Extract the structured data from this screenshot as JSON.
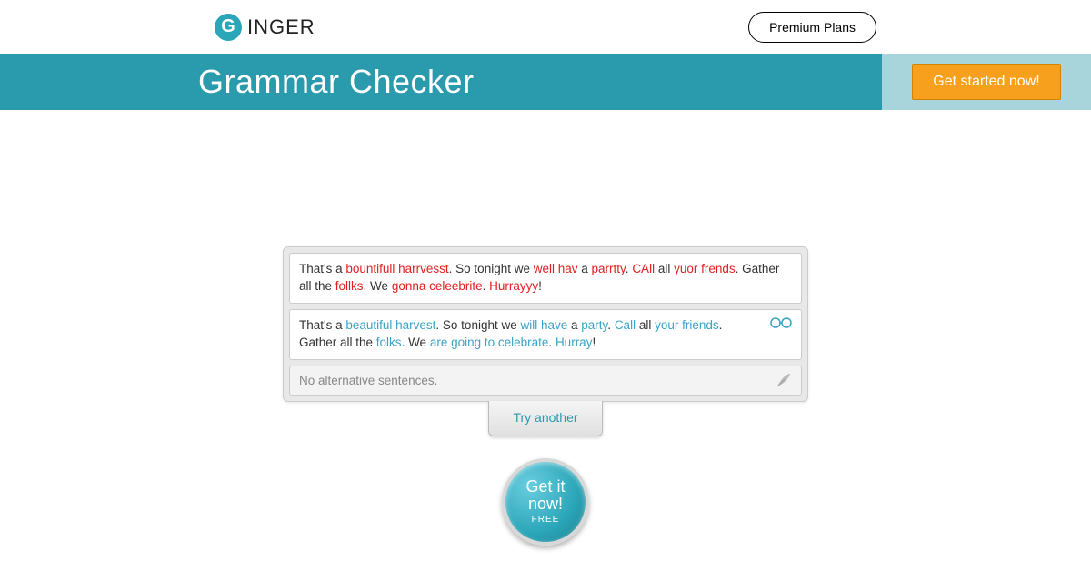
{
  "header": {
    "brand_letter": "G",
    "brand_rest": "INGER",
    "premium_label": "Premium Plans"
  },
  "hero": {
    "title": "Grammar Checker",
    "cta_label": "Get started now!"
  },
  "checker": {
    "original": {
      "segments": [
        {
          "t": "That's a ",
          "c": ""
        },
        {
          "t": "bountifull harrvesst",
          "c": "err"
        },
        {
          "t": ". So tonight we ",
          "c": ""
        },
        {
          "t": "well hav",
          "c": "err"
        },
        {
          "t": " a ",
          "c": ""
        },
        {
          "t": "parrtty",
          "c": "err"
        },
        {
          "t": ". ",
          "c": ""
        },
        {
          "t": "CAll",
          "c": "err"
        },
        {
          "t": " all ",
          "c": ""
        },
        {
          "t": "yuor frends",
          "c": "err"
        },
        {
          "t": ". Gather all the ",
          "c": ""
        },
        {
          "t": "follks",
          "c": "err"
        },
        {
          "t": ". We ",
          "c": ""
        },
        {
          "t": "gonna celeebrite",
          "c": "err"
        },
        {
          "t": ". ",
          "c": ""
        },
        {
          "t": "Hurrayyy",
          "c": "err"
        },
        {
          "t": "!",
          "c": ""
        }
      ]
    },
    "corrected": {
      "segments": [
        {
          "t": "That's a ",
          "c": ""
        },
        {
          "t": "beautiful harvest",
          "c": "fix"
        },
        {
          "t": ". So tonight we ",
          "c": ""
        },
        {
          "t": "will have",
          "c": "fix"
        },
        {
          "t": " a ",
          "c": ""
        },
        {
          "t": "party",
          "c": "fix"
        },
        {
          "t": ". ",
          "c": ""
        },
        {
          "t": "Call",
          "c": "fix"
        },
        {
          "t": " all ",
          "c": ""
        },
        {
          "t": "your friends",
          "c": "fix"
        },
        {
          "t": ". Gather all the ",
          "c": ""
        },
        {
          "t": "folks",
          "c": "fix"
        },
        {
          "t": ". We ",
          "c": ""
        },
        {
          "t": "are going to celebrate",
          "c": "fix"
        },
        {
          "t": ". ",
          "c": ""
        },
        {
          "t": "Hurray",
          "c": "fix"
        },
        {
          "t": "!",
          "c": ""
        }
      ]
    },
    "alt_text": "No alternative sentences.",
    "try_another_label": "Try another"
  },
  "get_it": {
    "line1": "Get it",
    "line2": "now!",
    "sub": "FREE"
  }
}
